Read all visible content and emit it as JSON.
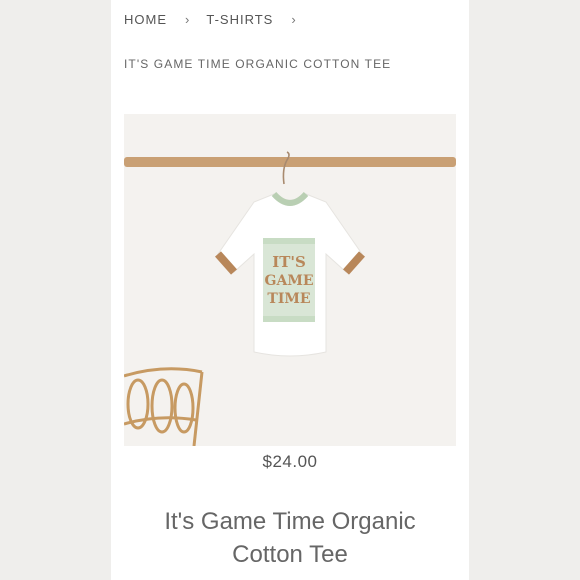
{
  "breadcrumb": {
    "home": "HOME",
    "category": "T-SHIRTS",
    "separator": "›",
    "current": "IT'S GAME TIME ORGANIC COTTON TEE"
  },
  "product": {
    "image_text_line1": "IT'S",
    "image_text_line2": "GAME",
    "image_text_line3": "TIME",
    "price": "$24.00",
    "title_line1": "It's Game Time Organic",
    "title_line2": "Cotton Tee"
  },
  "colors": {
    "page_background": "#efeeec",
    "text_gray": "#666666",
    "shirt_trim_green": "#b9cfb3",
    "shirt_sleeve_tan": "#b8875a",
    "rod_wood": "#c9a074"
  }
}
